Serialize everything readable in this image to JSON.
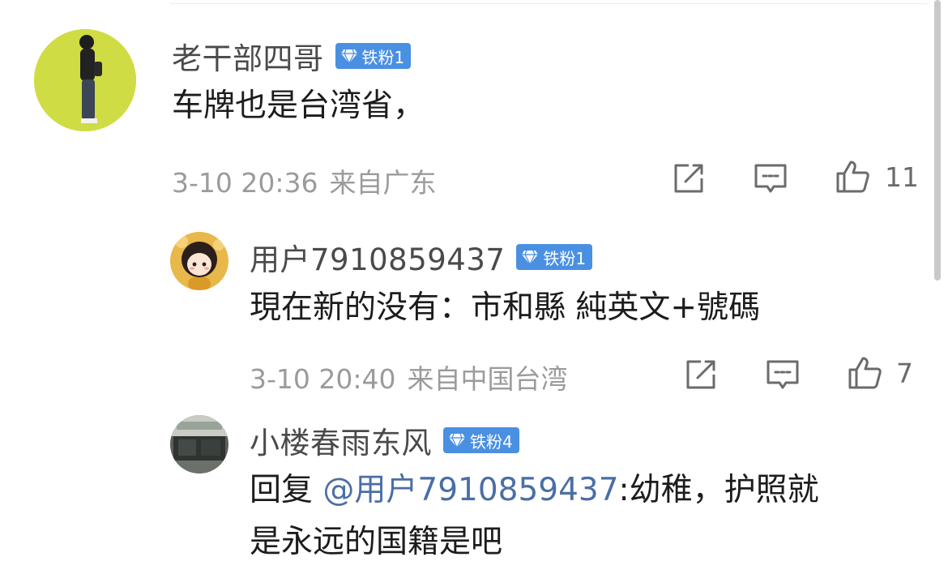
{
  "comments": [
    {
      "name": "老干部四哥",
      "badge": "铁粉1",
      "text": "车牌也是台湾省，",
      "time": "3-10 20:36",
      "location": "来自广东",
      "likes": "11"
    },
    {
      "name": "用户7910859437",
      "badge": "铁粉1",
      "text": "現在新的没有：市和縣 純英文+號碼",
      "time": "3-10 20:40",
      "location": "来自中国台湾",
      "likes": "7"
    },
    {
      "name": "小楼春雨东风",
      "badge": "铁粉4",
      "reply_prefix": "回复 ",
      "mention": "@用户7910859437",
      "text_line1": ":幼稚，护照就",
      "text_line2": "是永远的国籍是吧"
    }
  ],
  "colors": {
    "badge": "#4a90e2",
    "mention": "#4a6fa5",
    "meta": "#9b9b9b",
    "name": "#4a4a4a"
  },
  "icons": [
    "share-icon",
    "comment-icon",
    "like-icon",
    "diamond-icon"
  ]
}
